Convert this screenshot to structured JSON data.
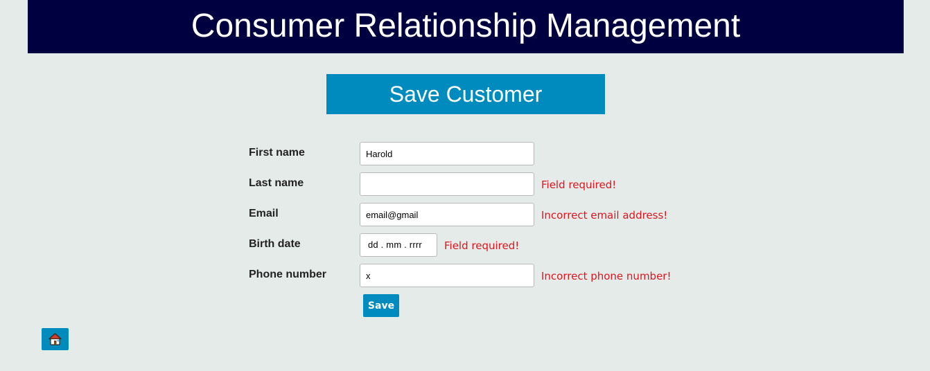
{
  "header": {
    "title": "Consumer Relationship Management"
  },
  "section": {
    "title": "Save Customer"
  },
  "form": {
    "first_name": {
      "label": "First name",
      "value": "Harold"
    },
    "last_name": {
      "label": "Last name",
      "value": "",
      "error": "Field required!"
    },
    "email": {
      "label": "Email",
      "value": "email@gmail",
      "error": "Incorrect email address!"
    },
    "birth_date": {
      "label": "Birth date",
      "placeholder": "dd . mm . rrrr",
      "value": "",
      "error": "Field required!"
    },
    "phone": {
      "label": "Phone number",
      "value": "x",
      "error": "Incorrect phone number!"
    },
    "save_label": "Save"
  },
  "home": {
    "icon": "home-icon"
  },
  "colors": {
    "header_bg": "#000040",
    "accent": "#008bbf",
    "error": "#e0141e",
    "page_bg": "#e5ebe9"
  }
}
